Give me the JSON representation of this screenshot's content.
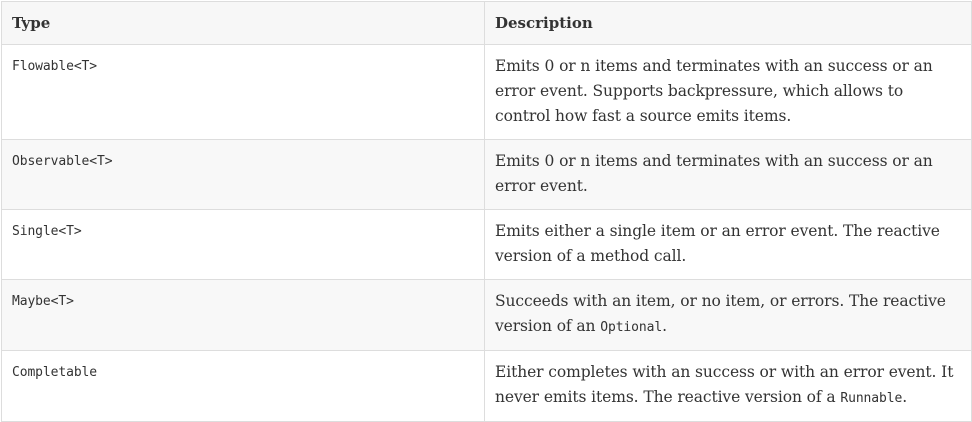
{
  "table": {
    "headers": {
      "type": "Type",
      "description": "Description"
    },
    "rows": [
      {
        "type": "Flowable<T>",
        "description": "Emits 0 or n items and terminates with an success or an error event. Supports backpressure, which allows to control how fast a source emits items."
      },
      {
        "type": "Observable<T>",
        "description": "Emits 0 or n items and terminates with an success or an error event."
      },
      {
        "type": "Single<T>",
        "description": "Emits either a single item or an error event. The reactive version of a method call."
      },
      {
        "type": "Maybe<T>",
        "description_before": "Succeeds with an item, or no item, or errors. The reactive version of an ",
        "description_code": "Optional",
        "description_after": "."
      },
      {
        "type": "Completable",
        "description_before": "Either completes with an success or with an error event. It never emits items. The reactive version of a ",
        "description_code": "Runnable",
        "description_after": "."
      }
    ]
  }
}
